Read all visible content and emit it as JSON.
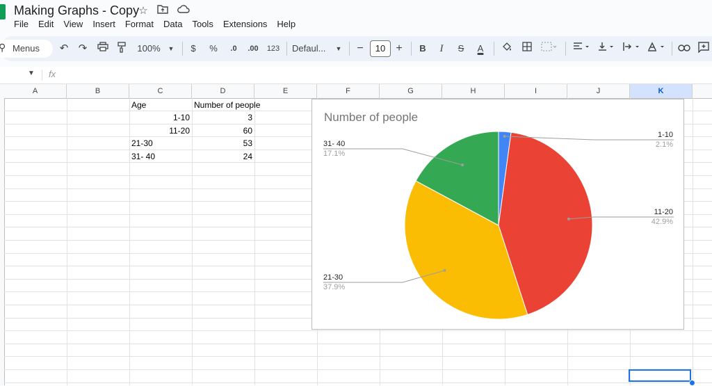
{
  "app": {
    "doc_title": "Making Graphs - Copy",
    "title_icons": [
      "star-icon",
      "move-to-folder-icon",
      "cloud-status-icon"
    ]
  },
  "menu": [
    "File",
    "Edit",
    "View",
    "Insert",
    "Format",
    "Data",
    "Tools",
    "Extensions",
    "Help"
  ],
  "toolbar": {
    "search_label": "Menus",
    "zoom": "100%",
    "currency": "$",
    "percent": "%",
    "decrease_decimal": ".0",
    "increase_decimal": ".00",
    "number_format": "123",
    "font": "Defaul...",
    "font_size": "10",
    "bold": "B",
    "italic": "I",
    "strike": "S",
    "text_color": "A"
  },
  "formula_bar": {
    "fx": "fx",
    "value": ""
  },
  "columns": [
    "A",
    "B",
    "C",
    "D",
    "E",
    "F",
    "G",
    "H",
    "I",
    "J",
    "K"
  ],
  "selected_column": "K",
  "sheet": {
    "header": {
      "c": "Age",
      "d": "Number of people"
    },
    "rows": [
      {
        "c": "1-10",
        "c_align": "right",
        "d": "3"
      },
      {
        "c": "11-20",
        "c_align": "right",
        "d": "60"
      },
      {
        "c": "21-30",
        "c_align": "left",
        "d": "53"
      },
      {
        "c": "31- 40",
        "c_align": "left",
        "d": "24"
      }
    ]
  },
  "chart_data": {
    "type": "pie",
    "title": "Number of people",
    "categories": [
      "1-10",
      "11-20",
      "21-30",
      "31- 40"
    ],
    "values": [
      3,
      60,
      53,
      24
    ],
    "percent_labels": [
      "2.1%",
      "42.9%",
      "37.9%",
      "17.1%"
    ],
    "colors": [
      "#4285f4",
      "#ea4335",
      "#fbbc04",
      "#34a853"
    ],
    "legend": "labeled",
    "start_angle_deg": 0
  }
}
